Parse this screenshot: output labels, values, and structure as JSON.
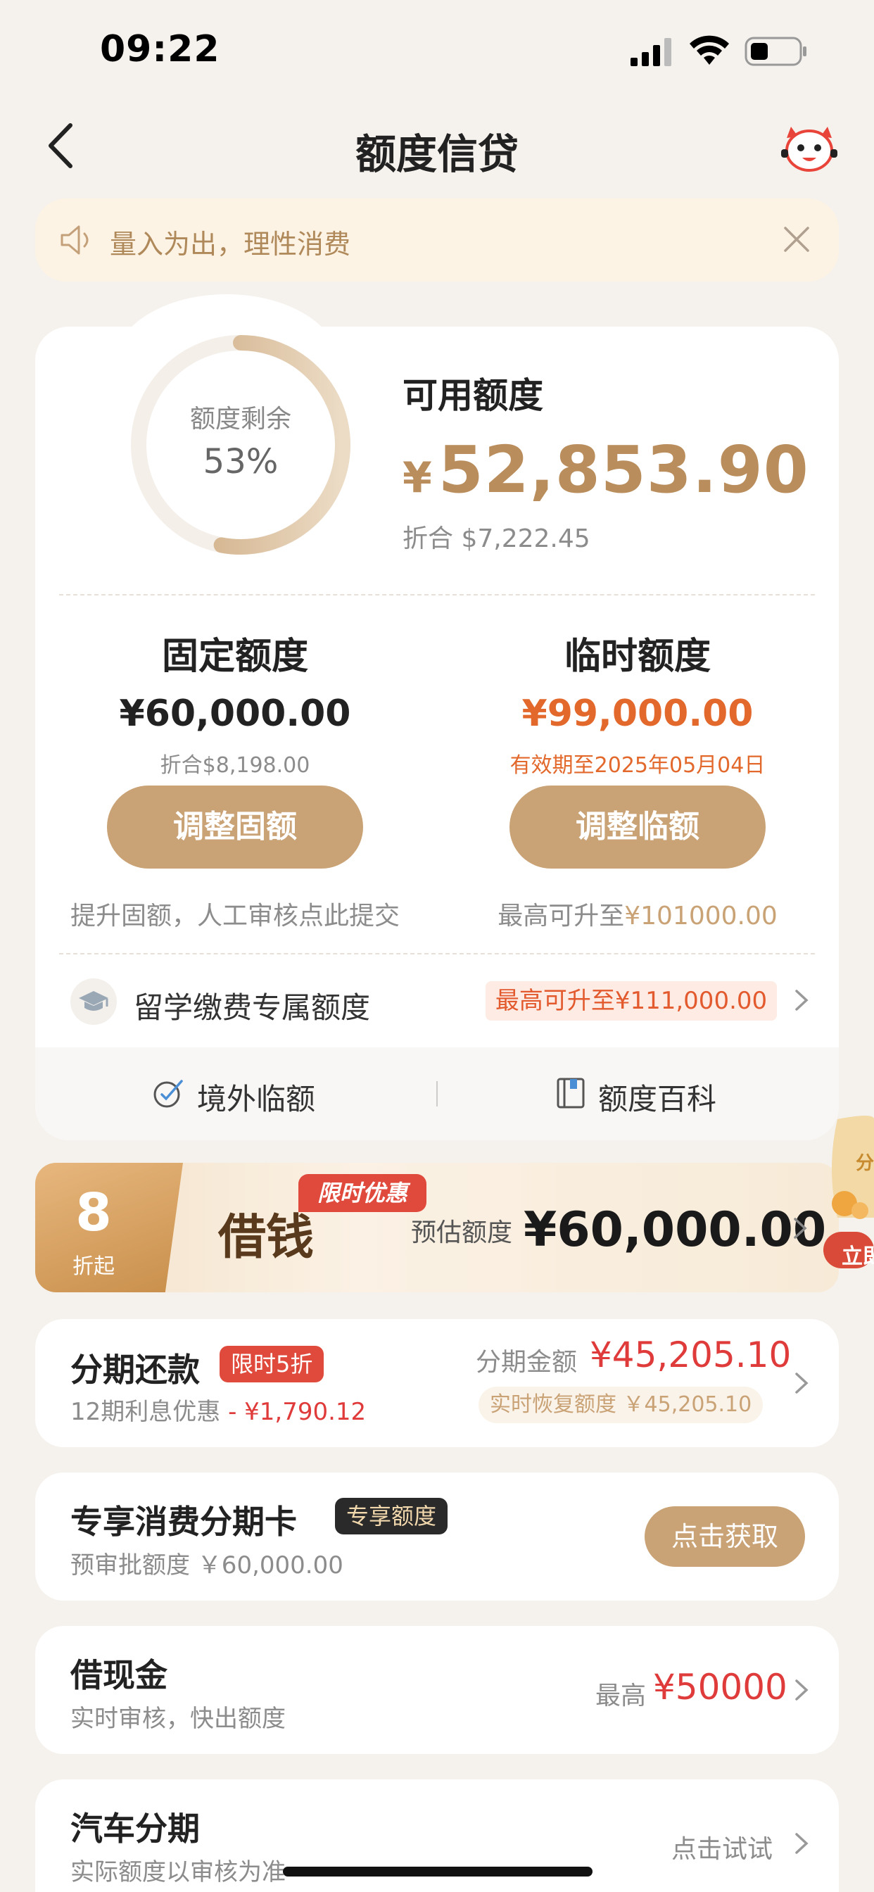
{
  "status_bar": {
    "time": "09:22"
  },
  "nav": {
    "title": "额度信贷"
  },
  "notice": {
    "text": "量入为出，理性消费"
  },
  "credit": {
    "ring_label": "额度剩余",
    "ring_percent": "53%",
    "ring_fraction": 0.53,
    "available_label": "可用额度",
    "available_currency": "¥",
    "available_amount": "52,853.90",
    "available_converted": "折合 $7,222.45"
  },
  "fixed": {
    "title": "固定额度",
    "amount": "¥60,000.00",
    "converted": "折合$8,198.00",
    "button": "调整固额",
    "hint": "提升固额，人工审核点此提交"
  },
  "temporary": {
    "title": "临时额度",
    "amount": "¥99,000.00",
    "validity": "有效期至2025年05月04日",
    "button": "调整临额",
    "hint_prefix": "最高可升至",
    "hint_amount": "¥101000.00"
  },
  "study": {
    "label": "留学缴费专属额度",
    "tag": "最高可升至¥111,000.00"
  },
  "footer_links": [
    {
      "label": "境外临额"
    },
    {
      "label": "额度百科"
    }
  ],
  "promo": {
    "discount_number": "8",
    "discount_unit": "折起",
    "title": "借钱",
    "badge": "限时优惠",
    "estimate_label": "预估额度",
    "estimate_amount": "¥60,000.00",
    "side_partial_top": "分",
    "side_partial_bottom": "立即"
  },
  "installment": {
    "title": "分期还款",
    "tag": "限时5折",
    "sub_prefix": "12期利息优惠 ",
    "sub_discount": "- ¥1,790.12",
    "amount_label": "分期金额",
    "amount": "¥45,205.10",
    "restore": "实时恢复额度 ￥45,205.10"
  },
  "card_product": {
    "title": "专享消费分期卡",
    "tag": "专享额度",
    "sub": "预审批额度 ￥60,000.00",
    "button": "点击获取"
  },
  "cash": {
    "title": "借现金",
    "sub": "实时审核，快出额度",
    "max_label": "最高",
    "max_amount": "¥50000"
  },
  "car": {
    "title": "汽车分期",
    "sub": "实际额度以审核为准",
    "action": "点击试试"
  },
  "colors": {
    "gold": "#c9a275",
    "accent_red": "#e03b3b",
    "orange": "#e2682c",
    "background": "#f5f1ec"
  }
}
